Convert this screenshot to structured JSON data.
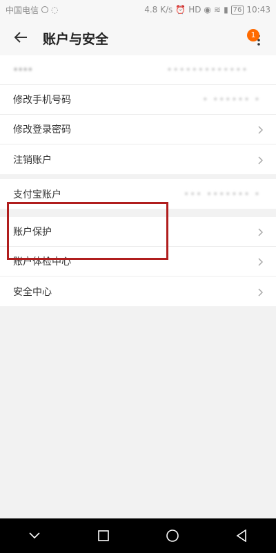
{
  "status_bar": {
    "carrier": "中国电信",
    "speed": "4.8 K/s",
    "battery": "76",
    "time": "10:43"
  },
  "header": {
    "title": "账户与安全",
    "badge": "1"
  },
  "group1": {
    "rows": [
      {
        "label": "••••",
        "value": "•••••••••••••"
      },
      {
        "label": "修改手机号码",
        "value": "• •••••• •"
      },
      {
        "label": "修改登录密码",
        "value": ""
      },
      {
        "label": "注销账户",
        "value": ""
      }
    ]
  },
  "group2": {
    "rows": [
      {
        "label": "支付宝账户",
        "value": "•••  •••••••  •"
      }
    ]
  },
  "group3": {
    "rows": [
      {
        "label": "账户保护"
      },
      {
        "label": "账户体检中心"
      },
      {
        "label": "安全中心"
      }
    ]
  },
  "colors": {
    "accent": "#ff6a00",
    "highlight": "#b01d1d"
  }
}
